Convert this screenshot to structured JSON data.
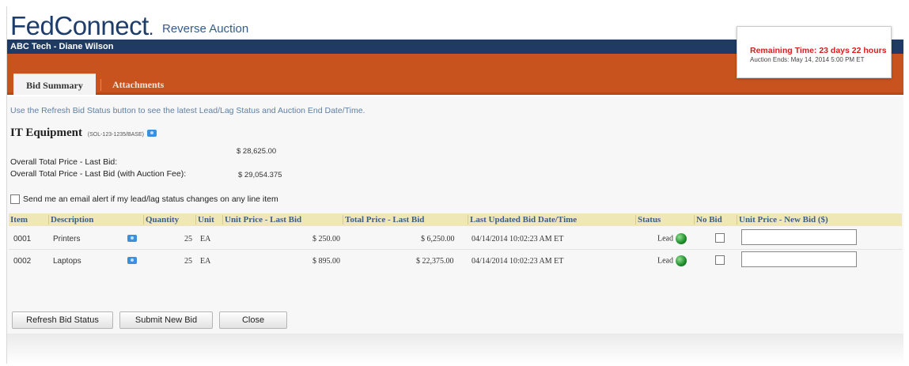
{
  "app": {
    "logo": "FedConnect",
    "logo_mark": ".",
    "subtitle": "Reverse Auction",
    "user": "ABC Tech - Diane Wilson"
  },
  "tabs": [
    {
      "label": "Bid Summary",
      "active": true
    },
    {
      "label": "Attachments",
      "active": false
    }
  ],
  "timer": {
    "remaining": "Remaining Time:  23 days  22 hours",
    "ends": "Auction Ends:  May 14, 2014   5:00 PM ET"
  },
  "info_text": "Use the Refresh Bid Status button to see the latest Lead/Lag Status and Auction End Date/Time.",
  "solicitation": {
    "title": "IT Equipment",
    "number": "(SOL-123-1235/BASE)"
  },
  "prices": {
    "last_bid_label": "Overall Total Price - Last Bid:",
    "last_bid_value": "$ 28,625.00",
    "fee_label": "Overall Total Price - Last Bid (with Auction Fee):",
    "fee_value": "$ 29,054.375"
  },
  "email_alert_label": "Send me an email alert if my lead/lag status changes on any line item",
  "table": {
    "headers": {
      "item": "Item",
      "description": "Description",
      "quantity": "Quantity",
      "unit": "Unit",
      "unit_price": "Unit Price - Last Bid",
      "total_price": "Total Price - Last Bid",
      "updated": "Last Updated Bid Date/Time",
      "status": "Status",
      "no_bid": "No Bid",
      "new_bid": "Unit Price - New Bid ($)"
    },
    "rows": [
      {
        "item": "0001",
        "description": "Printers",
        "quantity": "25",
        "unit": "EA",
        "unit_price": "$ 250.00",
        "total_price": "$ 6,250.00",
        "updated": "04/14/2014  10:02:23 AM  ET",
        "status": "Lead",
        "new_bid": ""
      },
      {
        "item": "0002",
        "description": "Laptops",
        "quantity": "25",
        "unit": "EA",
        "unit_price": "$ 895.00",
        "total_price": "$ 22,375.00",
        "updated": "04/14/2014  10:02:23 AM  ET",
        "status": "Lead",
        "new_bid": ""
      }
    ]
  },
  "buttons": {
    "refresh": "Refresh Bid Status",
    "submit": "Submit New Bid",
    "close": "Close"
  },
  "colors": {
    "navy": "#1f3a63",
    "orange": "#c9531f",
    "header_row": "#efe7b6",
    "alert_red": "#d4201b",
    "lead_green": "#1d8a2a"
  },
  "icons": [
    "camera-icon",
    "status-green-dot-icon"
  ]
}
